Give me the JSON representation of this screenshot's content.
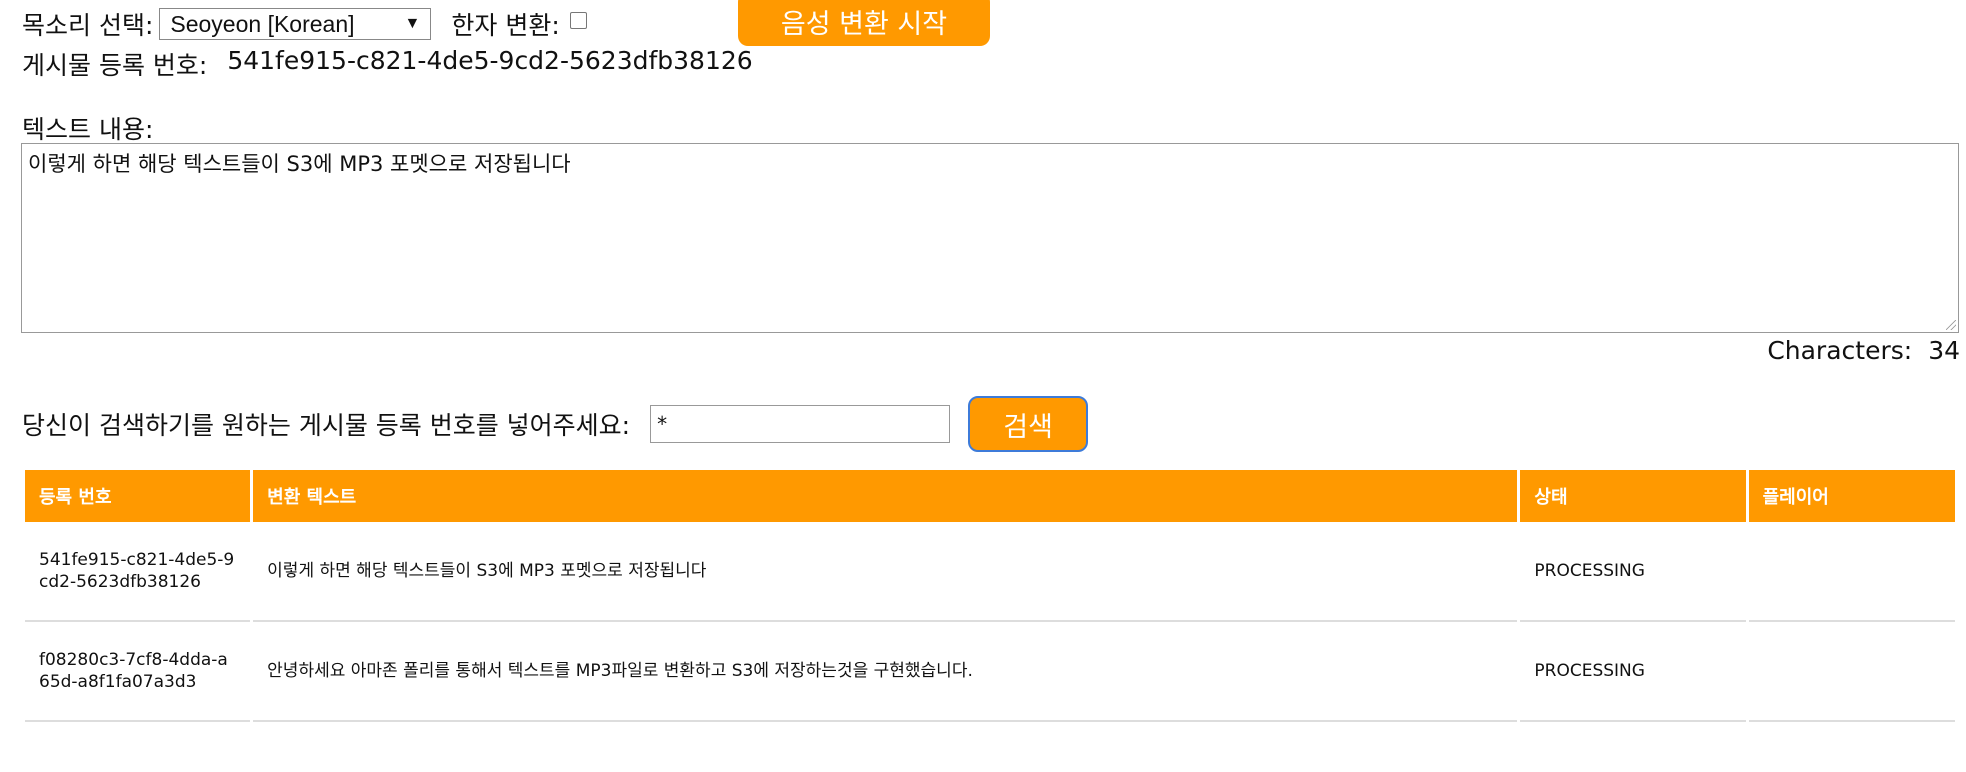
{
  "voice": {
    "label": "목소리 선택:",
    "selected": "Seoyeon [Korean]"
  },
  "hanja": {
    "label": "한자 변환:",
    "checked": false
  },
  "start_button": "음성 변환 시작",
  "post_id": {
    "label": "게시물 등록 번호:",
    "value": "541fe915-c821-4de5-9cd2-5623dfb38126"
  },
  "text_content": {
    "label": "텍스트 내용:",
    "value": "이렇게 하면 해당 텍스트들이 S3에 MP3 포멧으로 저장됩니다"
  },
  "char_count": {
    "label": "Characters:",
    "value": "34"
  },
  "search": {
    "label": "당신이 검색하기를 원하는 게시물 등록 번호를 넣어주세요:",
    "value": "*",
    "button": "검색"
  },
  "table": {
    "headers": [
      "등록 번호",
      "변환 텍스트",
      "상태",
      "플레이어"
    ],
    "rows": [
      {
        "id": "541fe915-c821-4de5-9cd2-5623dfb38126",
        "text": "이렇게 하면 해당 텍스트들이 S3에 MP3 포멧으로 저장됩니다",
        "status": "PROCESSING",
        "player": ""
      },
      {
        "id": "f08280c3-7cf8-4dda-a65d-a8f1fa07a3d3",
        "text": "안녕하세요 아마존 폴리를 통해서 텍스트를 MP3파일로 변환하고 S3에 저장하는것을 구현했습니다.",
        "status": "PROCESSING",
        "player": ""
      }
    ]
  },
  "colors": {
    "accent": "#ff9900",
    "focus_border": "#3d7bd9"
  }
}
